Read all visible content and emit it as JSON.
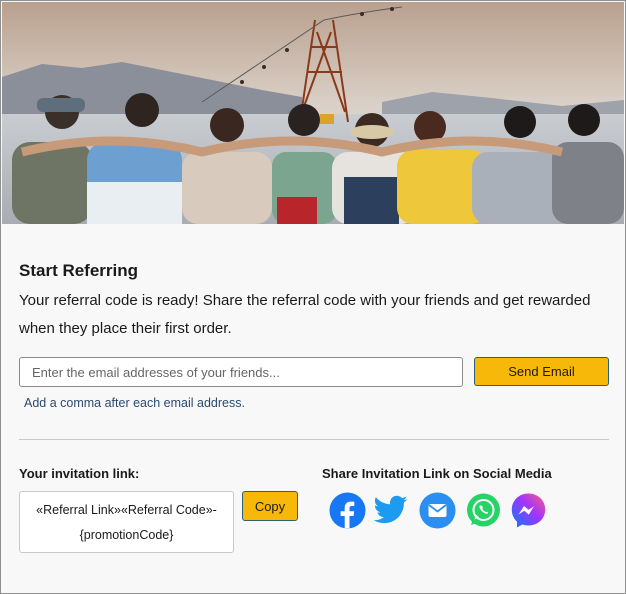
{
  "hero": {
    "image": "group-of-friends-arms-around-shoulders-photo"
  },
  "referral": {
    "title": "Start Referring",
    "description": "Your referral code is ready! Share the referral code with your friends and get rewarded when they place their first order.",
    "email_placeholder": "Enter the email addresses of your friends...",
    "send_label": "Send Email",
    "hint": "Add a comma after each email address."
  },
  "invitation": {
    "label": "Your invitation link:",
    "link_line1": "«Referral Link»«Referral Code»-",
    "link_line2": "{promotionCode}",
    "copy_label": "Copy"
  },
  "social": {
    "label": "Share Invitation Link on Social Media",
    "icons": [
      "facebook-icon",
      "twitter-icon",
      "email-icon",
      "whatsapp-icon",
      "messenger-icon"
    ]
  },
  "colors": {
    "accent_button": "#f7b80a",
    "button_border": "#2c5f7a",
    "facebook": "#1877f2",
    "twitter": "#1d9bf0",
    "email": "#2a8ff0",
    "whatsapp": "#25d366",
    "messenger": "#a033ff"
  }
}
